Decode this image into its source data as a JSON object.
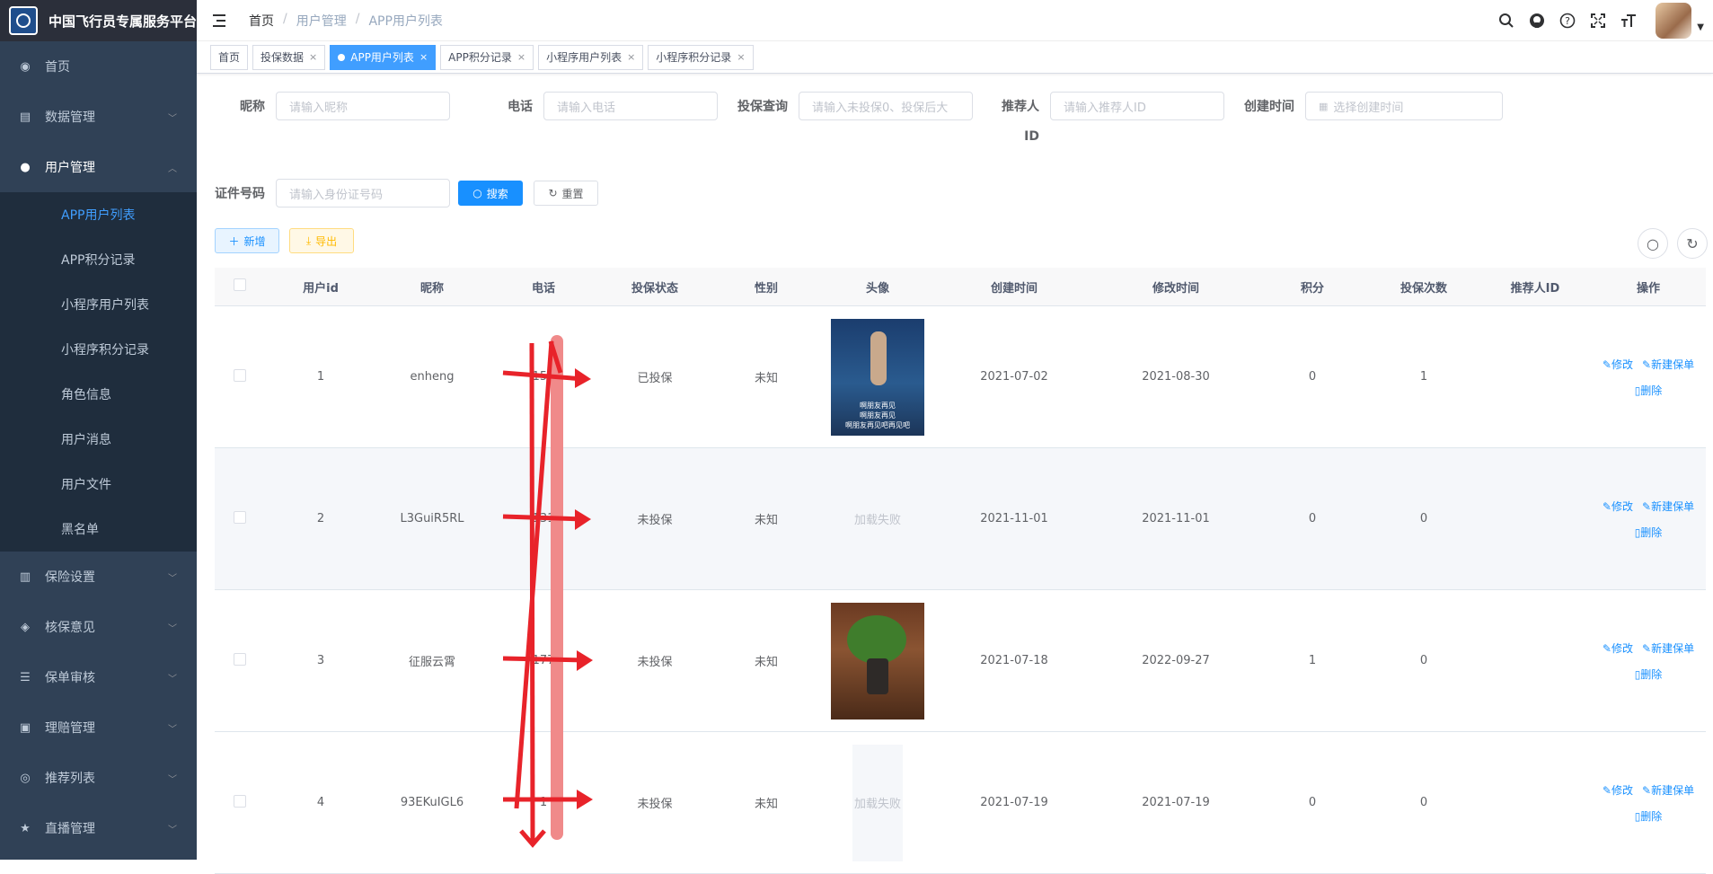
{
  "app": {
    "title": "中国飞行员专属服务平台"
  },
  "sidebar": {
    "items": [
      {
        "label": "首页",
        "icon": "dashboard-icon"
      },
      {
        "label": "数据管理",
        "icon": "data-icon"
      },
      {
        "label": "用户管理",
        "icon": "user-icon"
      },
      {
        "label": "保险设置",
        "icon": "book-icon"
      },
      {
        "label": "核保意见",
        "icon": "shield-icon"
      },
      {
        "label": "保单审核",
        "icon": "list-icon"
      },
      {
        "label": "理赔管理",
        "icon": "briefcase-icon"
      },
      {
        "label": "推荐列表",
        "icon": "target-icon"
      },
      {
        "label": "直播管理",
        "icon": "star-icon"
      }
    ],
    "submenu": [
      "APP用户列表",
      "APP积分记录",
      "小程序用户列表",
      "小程序积分记录",
      "角色信息",
      "用户消息",
      "用户文件",
      "黑名单"
    ]
  },
  "breadcrumb": [
    "首页",
    "用户管理",
    "APP用户列表"
  ],
  "tabs": [
    "首页",
    "投保数据",
    "APP用户列表",
    "APP积分记录",
    "小程序用户列表",
    "小程序积分记录"
  ],
  "search": {
    "nickname_label": "昵称",
    "nickname_placeholder": "请输入昵称",
    "phone_label": "电话",
    "phone_placeholder": "请输入电话",
    "insure_label": "投保查询",
    "insure_placeholder": "请输入未投保0、投保后大",
    "referrer_label": "推荐人",
    "referrer_label2": "ID",
    "referrer_placeholder": "请输入推荐人ID",
    "created_label": "创建时间",
    "created_placeholder": "选择创建时间",
    "idcard_label": "证件号码",
    "idcard_placeholder": "请输入身份证号码",
    "search_btn": "搜索",
    "reset_btn": "重置"
  },
  "toolbar": {
    "add": "新增",
    "export": "导出"
  },
  "table": {
    "columns": [
      "用户id",
      "昵称",
      "电话",
      "投保状态",
      "性别",
      "头像",
      "创建时间",
      "修改时间",
      "积分",
      "投保次数",
      "推荐人ID",
      "操作"
    ],
    "rows": [
      {
        "id": "1",
        "nickname": "enheng",
        "phone": "156",
        "status": "已投保",
        "gender": "未知",
        "avatar": "image",
        "created": "2021-07-02",
        "modified": "2021-08-30",
        "points": "0",
        "count": "1",
        "referrer": ""
      },
      {
        "id": "2",
        "nickname": "L3GuiR5RL",
        "phone": "131",
        "status": "未投保",
        "gender": "未知",
        "avatar": "加载失败",
        "created": "2021-11-01",
        "modified": "2021-11-01",
        "points": "0",
        "count": "0",
        "referrer": ""
      },
      {
        "id": "3",
        "nickname": "征服云霄",
        "phone": "177",
        "status": "未投保",
        "gender": "未知",
        "avatar": "image",
        "created": "2021-07-18",
        "modified": "2022-09-27",
        "points": "1",
        "count": "0",
        "referrer": ""
      },
      {
        "id": "4",
        "nickname": "93EKuIGL6",
        "phone": "1",
        "status": "未投保",
        "gender": "未知",
        "avatar": "加载失败",
        "created": "2021-07-19",
        "modified": "2021-07-19",
        "points": "0",
        "count": "0",
        "referrer": ""
      }
    ],
    "ops": {
      "edit": "修改",
      "new_policy": "新建保单",
      "delete": "删除"
    },
    "image1_caption": [
      "啊朋友再见",
      "啊朋友再见",
      "啊朋友再见吧再见吧"
    ]
  }
}
